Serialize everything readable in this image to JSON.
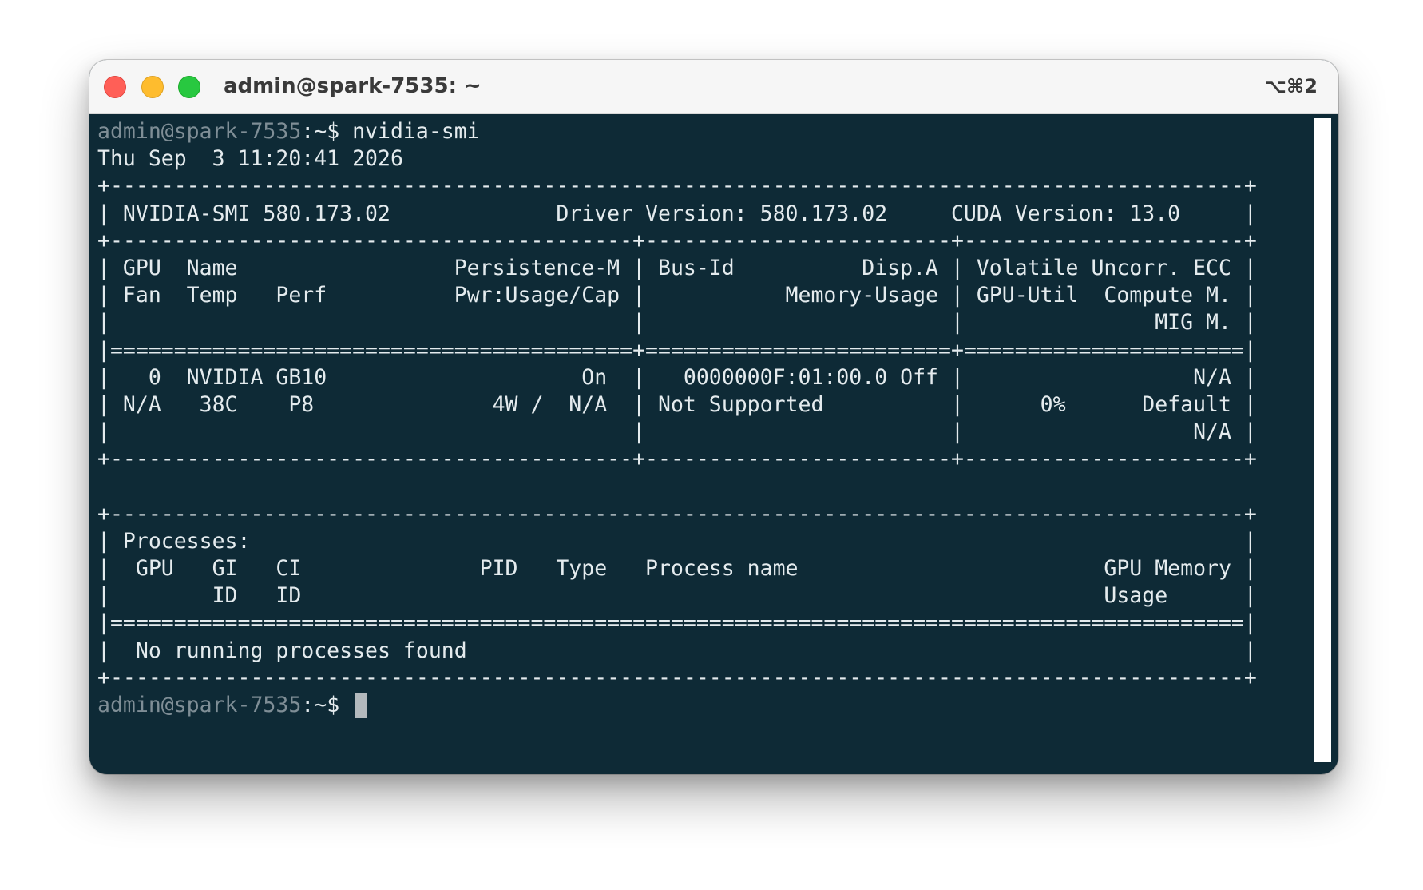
{
  "window": {
    "title": "admin@spark-7535: ~",
    "shortcut": "⌥⌘2"
  },
  "colors": {
    "terminal_background": "#0e2a36",
    "terminal_text": "#e4ebee",
    "prompt_text": "#7f8e96",
    "cursor": "#b3b9bd"
  },
  "terminal": {
    "prompt": "admin@spark-7535",
    "command_suffix": ":~$ nvidia-smi",
    "final_prompt_suffix": ":~$ ",
    "lines": [
      "Thu Sep  3 11:20:41 2026",
      "+-----------------------------------------------------------------------------------------+",
      "| NVIDIA-SMI 580.173.02             Driver Version: 580.173.02     CUDA Version: 13.0     |",
      "+-----------------------------------------+------------------------+----------------------+",
      "| GPU  Name                 Persistence-M | Bus-Id          Disp.A | Volatile Uncorr. ECC |",
      "| Fan  Temp   Perf          Pwr:Usage/Cap |           Memory-Usage | GPU-Util  Compute M. |",
      "|                                         |                        |               MIG M. |",
      "|=========================================+========================+======================|",
      "|   0  NVIDIA GB10                    On  |   0000000F:01:00.0 Off |                  N/A |",
      "| N/A   38C    P8              4W /  N/A  | Not Supported          |      0%      Default |",
      "|                                         |                        |                  N/A |",
      "+-----------------------------------------+------------------------+----------------------+",
      "",
      "+-----------------------------------------------------------------------------------------+",
      "| Processes:                                                                              |",
      "|  GPU   GI   CI              PID   Type   Process name                        GPU Memory |",
      "|        ID   ID                                                               Usage      |",
      "|=========================================================================================|",
      "|  No running processes found                                                             |",
      "+-----------------------------------------------------------------------------------------+"
    ]
  }
}
